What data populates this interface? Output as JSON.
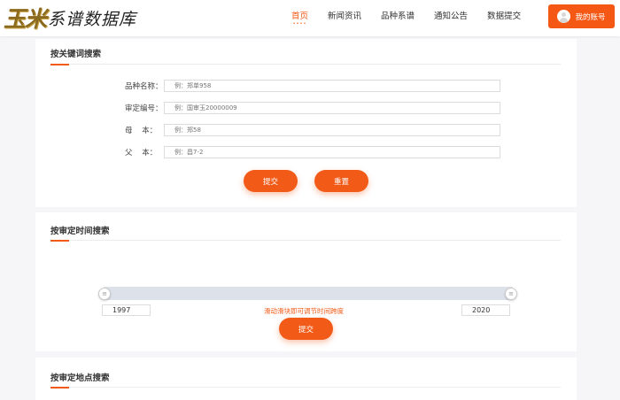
{
  "header": {
    "logo_art": "玉米",
    "logo_text": "系谱数据库",
    "nav": [
      {
        "label": "首页",
        "active": true,
        "dots": "••••"
      },
      {
        "label": "新闻资讯"
      },
      {
        "label": "品种系谱"
      },
      {
        "label": "通知公告"
      },
      {
        "label": "数据提交"
      }
    ],
    "account_label": "我的账号"
  },
  "keyword_search": {
    "title": "按关键词搜索",
    "fields": [
      {
        "label": "品种名称：",
        "placeholder": "例：郑单958"
      },
      {
        "label": "审定编号：",
        "placeholder": "例：国审玉20000009"
      },
      {
        "label": "母    本：",
        "placeholder": "例：郑58"
      },
      {
        "label": "父    本：",
        "placeholder": "例：昌7-2"
      }
    ],
    "submit_label": "提交",
    "reset_label": "重置"
  },
  "time_search": {
    "title": "按审定时间搜索",
    "handle_glyph": "≡",
    "start_year": "1997",
    "end_year": "2020",
    "hint": "滑动滑块即可调节时间跨度",
    "submit_label": "提交"
  },
  "location_search": {
    "title": "按审定地点搜索"
  },
  "colors": {
    "accent": "#f25a17",
    "logo": "#8a6a1d"
  }
}
